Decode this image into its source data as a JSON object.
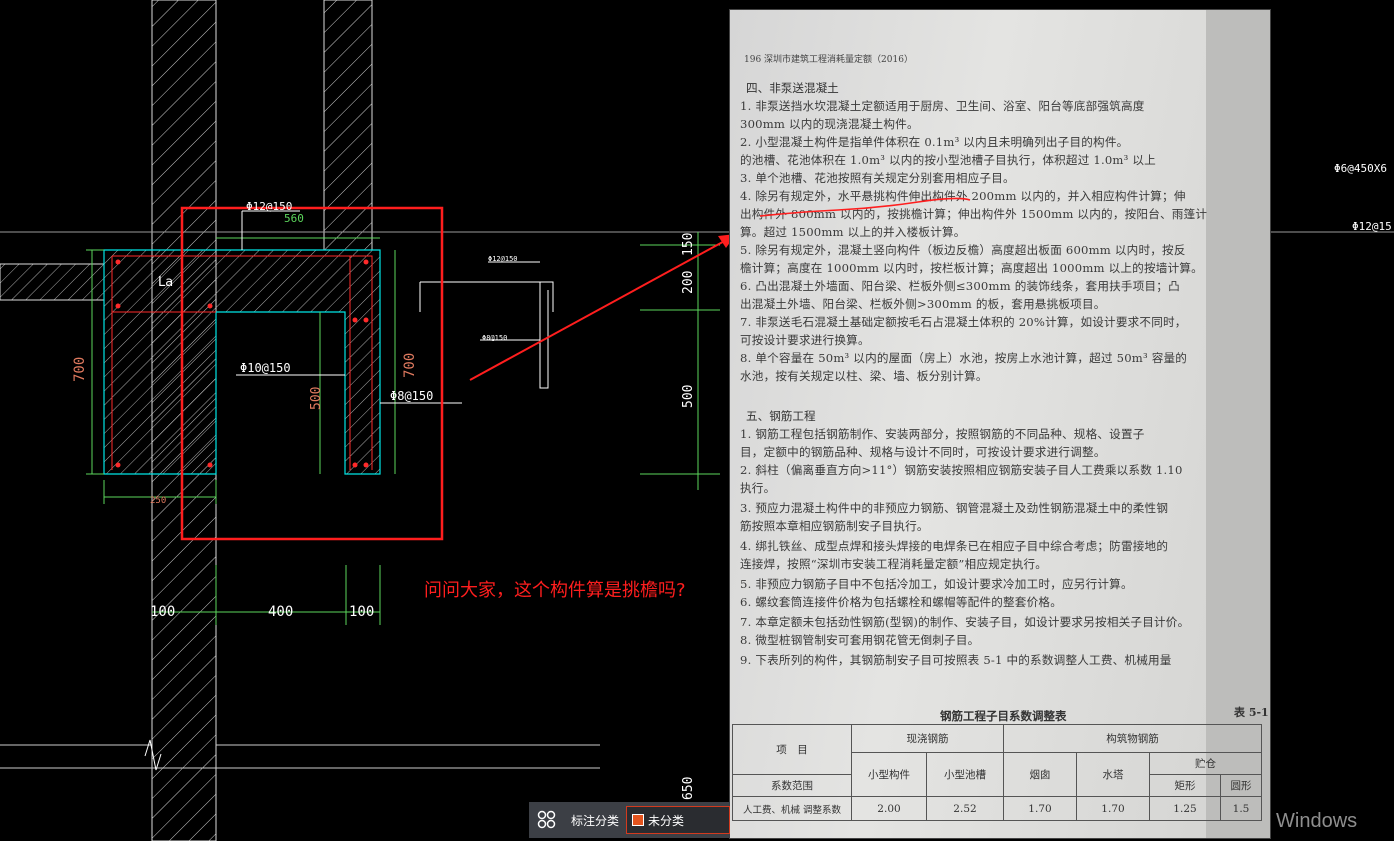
{
  "cad": {
    "rebar_top": "Φ12@150",
    "dim_top": "560",
    "label_la": "La",
    "dim_wall_h": "700",
    "rebar_inner": "Φ10@150",
    "dim_500": "500",
    "dim_700_right": "700",
    "rebar_right": "Φ8@150",
    "dim_250": "250",
    "dim_150": "150",
    "dim_200": "200",
    "dim_500_b": "500",
    "dim_650": "650",
    "dim_100_l": "100",
    "dim_400": "400",
    "dim_100_r": "100",
    "small_rebar_1": "Φ12@150",
    "small_rebar_2": "Φ8@150",
    "side_label_1": "Φ6@450X6",
    "side_label_2": "Φ12@15"
  },
  "question": "问问大家，这个构件算是挑檐吗?",
  "photo": {
    "page_header": "196   深圳市建筑工程消耗量定额（2016）",
    "lines": [
      "四、非泵送混凝土",
      "1. 非泵送挡水坎混凝土定额适用于厨房、卫生间、浴室、阳台等底部强筑高度",
      "300mm 以内的现浇混凝土构件。",
      "2. 小型混凝土构件是指单件体积在 0.1m³ 以内且未明确列出子目的构件。",
      "的池槽、花池体积在 1.0m³ 以内的按小型池槽子目执行，体积超过 1.0m³ 以上",
      "3. 单个池槽、花池按照有关规定分别套用相应子目。",
      "4. 除另有规定外，水平悬挑构件伸出构件外 200mm 以内的，并入相应构件计算；伸",
      "出构件外 800mm 以内的，按挑檐计算；伸出构件外 1500mm 以内的，按阳台、雨篷计",
      "算。超过 1500mm 以上的并入楼板计算。",
      "5. 除另有规定外，混凝土竖向构件（板边反檐）高度超出板面 600mm 以内时，按反",
      "檐计算；高度在 1000mm 以内时，按栏板计算；高度超出 1000mm 以上的按墙计算。",
      "6. 凸出混凝土外墙面、阳台梁、栏板外侧≤300mm 的装饰线条，套用扶手项目；凸",
      "出混凝土外墙、阳台梁、栏板外侧>300mm 的板，套用悬挑板项目。",
      "7. 非泵送毛石混凝土基础定额按毛石占混凝土体积的 20%计算，如设计要求不同时，",
      "可按设计要求进行换算。",
      "8. 单个容量在 50m³ 以内的屋面（房上）水池，按房上水池计算，超过 50m³ 容量的",
      "水池，按有关规定以柱、梁、墙、板分别计算。",
      "五、钢筋工程",
      "1. 钢筋工程包括钢筋制作、安装两部分，按照钢筋的不同品种、规格、设置子",
      "目，定额中的钢筋品种、规格与设计不同时，可按设计要求进行调整。",
      "2. 斜柱（偏离垂直方向>11°）钢筋安装按照相应钢筋安装子目人工费乘以系数 1.10",
      "执行。",
      "3. 预应力混凝土构件中的非预应力钢筋、钢管混凝土及劲性钢筋混凝土中的柔性钢",
      "筋按照本章相应钢筋制安子目执行。",
      "4. 绑扎铁丝、成型点焊和接头焊接的电焊条已在相应子目中综合考虑；防雷接地的",
      "连接焊，按照“深圳市安装工程消耗量定额”相应规定执行。",
      "5. 非预应力钢筋子目中不包括冷加工，如设计要求冷加工时，应另行计算。",
      "6. 螺纹套筒连接件价格为包括螺栓和螺帽等配件的整套价格。",
      "7. 本章定额未包括劲性钢筋(型钢)的制作、安装子目，如设计要求另按相关子目计价。",
      "8. 微型桩钢管制安可套用钢花管无倒刺子目。",
      "9. 下表所列的构件，其钢筋制安子目可按照表 5-1 中的系数调整人工费、机械用量"
    ],
    "table_title": "钢筋工程子目系数调整表",
    "table_no": "表 5-1",
    "table": {
      "h_item": "项　目",
      "h_cast": "现浇钢筋",
      "h_struct": "构筑物钢筋",
      "h_range": "系数范围",
      "h_small": "小型构件",
      "h_pool": "小型池槽",
      "h_chimney": "烟囱",
      "h_tower": "水塔",
      "h_silo": "贮仓",
      "h_rect": "矩形",
      "h_round": "圆形",
      "row_label": "人工费、机械 调整系数",
      "v_small": "2.00",
      "v_pool": "2.52",
      "v_chimney": "1.70",
      "v_tower": "1.70",
      "v_rect": "1.25",
      "v_round": "1.5"
    }
  },
  "statusbar": {
    "label": "标注分类",
    "value": "未分类",
    "swatch_color": "#e4541e"
  },
  "watermark": "Windows"
}
